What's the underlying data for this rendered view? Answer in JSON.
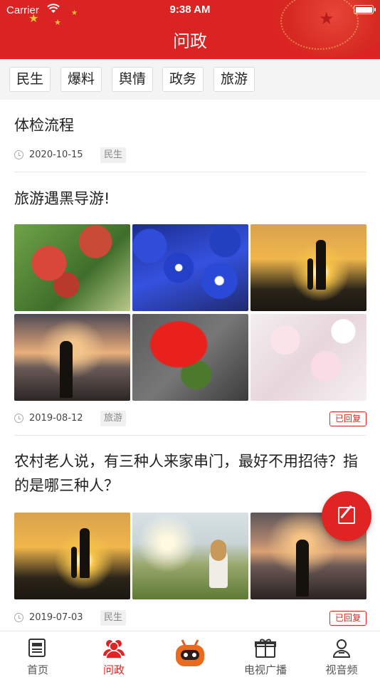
{
  "status_bar": {
    "carrier": "Carrier",
    "time": "9:38 AM"
  },
  "header": {
    "title": "问政"
  },
  "categories": [
    "民生",
    "爆料",
    "舆情",
    "政务",
    "旅游"
  ],
  "posts": [
    {
      "title": "体检流程",
      "date": "2020-10-15",
      "tag": "民生"
    },
    {
      "title": "旅游遇黑导游!",
      "date": "2019-08-12",
      "tag": "旅游",
      "status": "已回复"
    },
    {
      "title": "农村老人说，有三种人来家串门，最好不用招待？指的是哪三种人？",
      "date": "2019-07-03",
      "tag": "民生",
      "status": "已回复"
    }
  ],
  "tab_bar": [
    {
      "label": "首页",
      "icon": "newspaper-icon"
    },
    {
      "label": "问政",
      "icon": "people-icon",
      "active": true
    },
    {
      "label": "",
      "icon": "robot-icon"
    },
    {
      "label": "电视广播",
      "icon": "tv-gift-icon"
    },
    {
      "label": "视音频",
      "icon": "person-icon"
    }
  ],
  "colors": {
    "brand": "#dc2323",
    "accent": "#e02424"
  }
}
